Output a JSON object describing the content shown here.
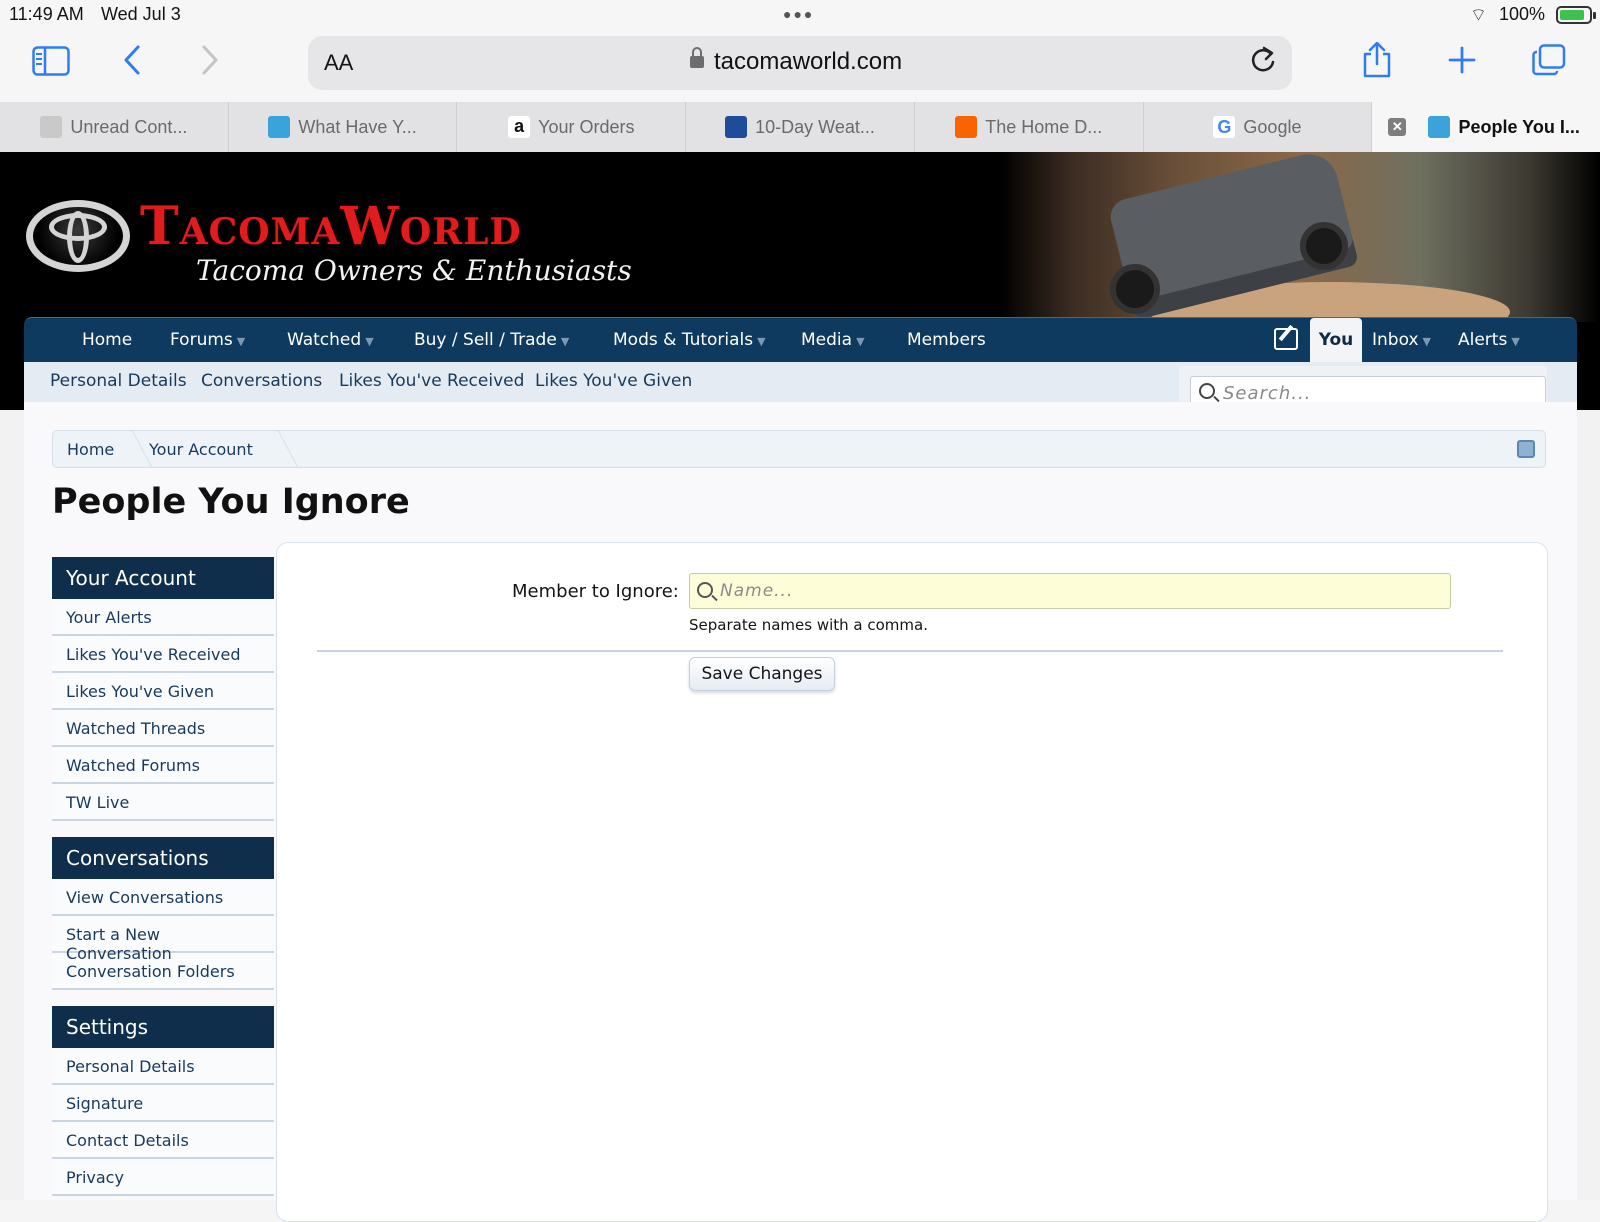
{
  "status_bar": {
    "time": "11:49 AM",
    "date": "Wed Jul 3",
    "battery": "100%"
  },
  "browser": {
    "aa_label": "AA",
    "url": "tacomaworld.com",
    "tabs": [
      {
        "label": "Unread Cont..."
      },
      {
        "label": "What Have Y..."
      },
      {
        "label": "Your Orders"
      },
      {
        "label": "10-Day Weat..."
      },
      {
        "label": "The Home D..."
      },
      {
        "label": "Google"
      },
      {
        "label": "People You I..."
      }
    ]
  },
  "site": {
    "brand": "TacomaWorld",
    "tagline": "Tacoma Owners & Enthusiasts",
    "main_nav": {
      "items": [
        "Home",
        "Forums",
        "Watched",
        "Buy / Sell / Trade",
        "Mods & Tutorials",
        "Media",
        "Members"
      ],
      "you": "You",
      "inbox": "Inbox",
      "alerts": "Alerts"
    },
    "sub_nav": [
      "Personal Details",
      "Conversations",
      "Likes You've Received",
      "Likes You've Given"
    ],
    "search_placeholder": "Search..."
  },
  "breadcrumb": [
    "Home",
    "Your Account"
  ],
  "page_title": "People You Ignore",
  "sidebar": {
    "sections": [
      {
        "title": "Your Account",
        "items": [
          "Your Alerts",
          "Likes You've Received",
          "Likes You've Given",
          "Watched Threads",
          "Watched Forums",
          "TW Live"
        ]
      },
      {
        "title": "Conversations",
        "items": [
          "View Conversations",
          "Start a New Conversation",
          "Conversation Folders"
        ]
      },
      {
        "title": "Settings",
        "items": [
          "Personal Details",
          "Signature",
          "Contact Details",
          "Privacy"
        ]
      }
    ]
  },
  "form": {
    "label": "Member to Ignore:",
    "placeholder": "Name...",
    "hint": "Separate names with a comma.",
    "save_label": "Save Changes"
  },
  "colors": {
    "nav_bg": "#0e3a5f",
    "brand_red": "#e01c1c",
    "accent_blue": "#2f7bf0"
  }
}
